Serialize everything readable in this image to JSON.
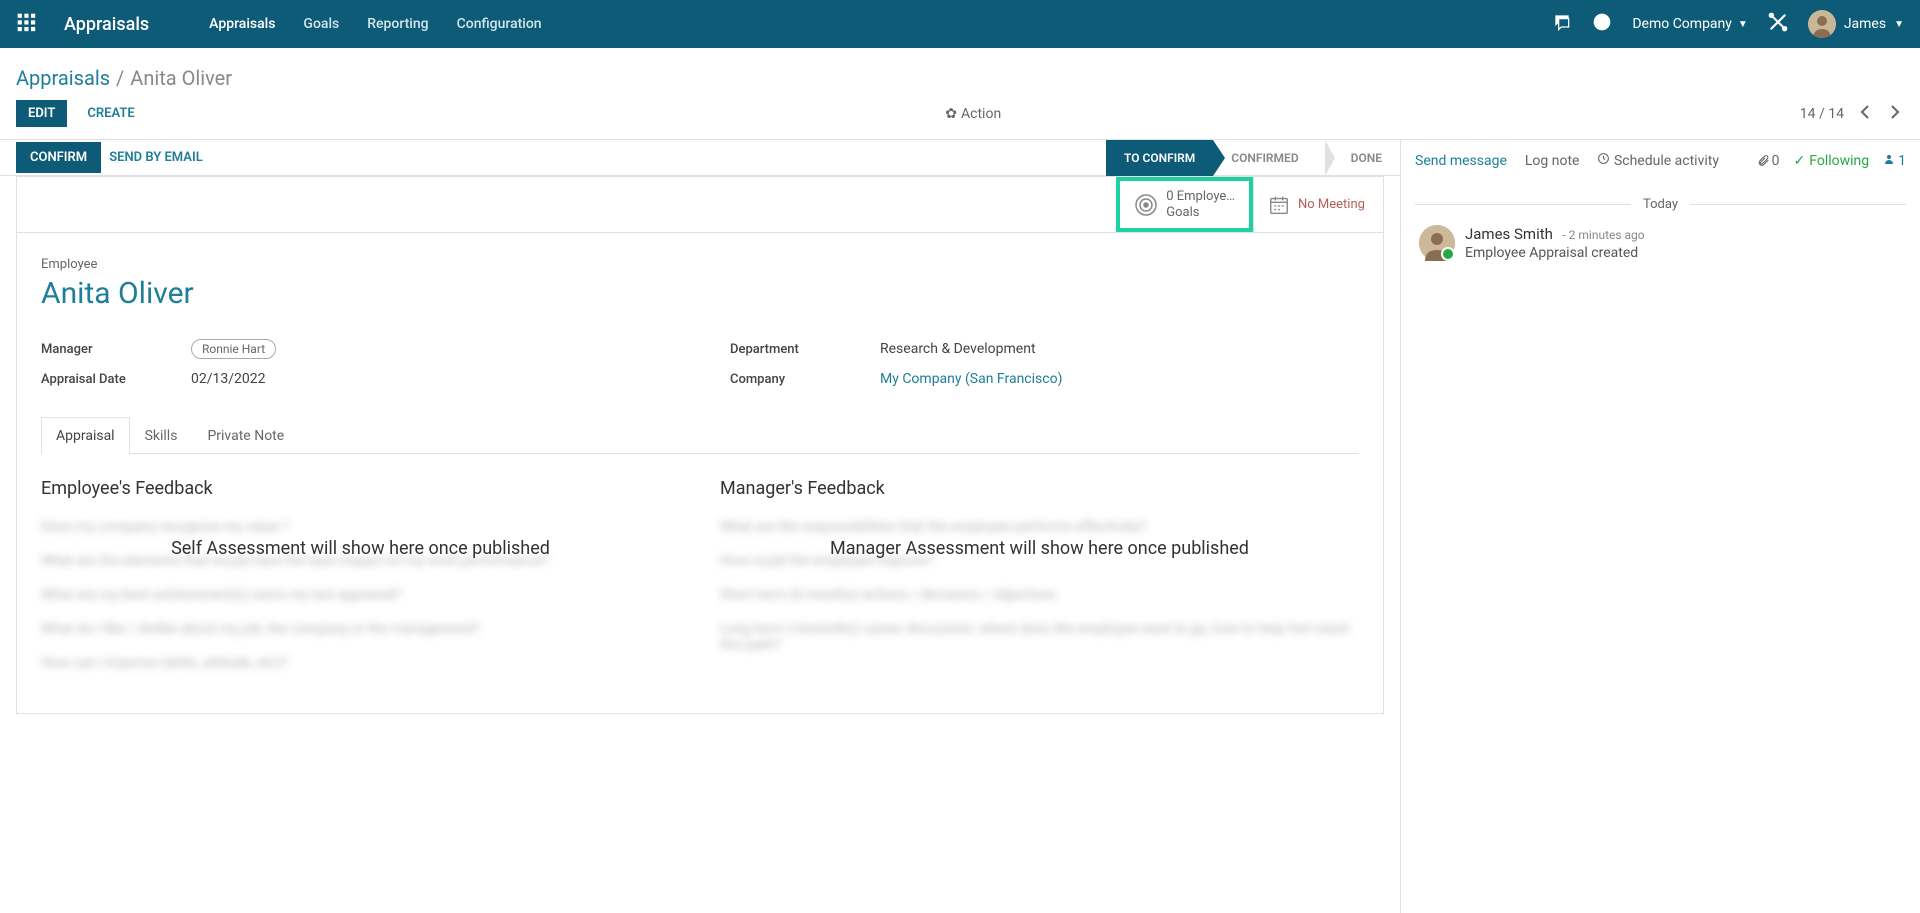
{
  "topbar": {
    "app_title": "Appraisals",
    "nav": [
      "Appraisals",
      "Goals",
      "Reporting",
      "Configuration"
    ],
    "company": "Demo Company",
    "user": "James"
  },
  "breadcrumb": {
    "root": "Appraisals",
    "current": "Anita Oliver"
  },
  "controls": {
    "edit": "EDIT",
    "create": "CREATE",
    "action": "Action",
    "pager": "14 / 14"
  },
  "statusbar": {
    "confirm": "CONFIRM",
    "send_email": "SEND BY EMAIL",
    "stages": [
      "TO CONFIRM",
      "CONFIRMED",
      "DONE"
    ]
  },
  "buttonbox": {
    "goals_line1": "0 Employe…",
    "goals_line2": "Goals",
    "meeting": "No Meeting"
  },
  "form": {
    "employee_label": "Employee",
    "employee_name": "Anita Oliver",
    "manager_label": "Manager",
    "manager_value": "Ronnie Hart",
    "date_label": "Appraisal Date",
    "date_value": "02/13/2022",
    "dept_label": "Department",
    "dept_value": "Research & Development",
    "company_label": "Company",
    "company_value": "My Company (San Francisco)"
  },
  "tabs": [
    "Appraisal",
    "Skills",
    "Private Note"
  ],
  "feedback": {
    "emp_title": "Employee's Feedback",
    "emp_placeholder": "Self Assessment will show here once published",
    "emp_blur": [
      "Does my company recognize my value ?",
      "What are the elements that would have the best impact on my work performance?",
      "What are my best achievement(s) since my last appraisal?",
      "What do I like / dislike about my job, the company or the management?",
      "How can I improve (skills, attitude, etc)?"
    ],
    "mgr_title": "Manager's Feedback",
    "mgr_placeholder": "Manager Assessment will show here once published",
    "mgr_blur": [
      "What are the responsibilities that the employee performs effectively?",
      "How could the employee improve?",
      "Short term (6-months) actions / decisions / objectives",
      "Long term (>6months) career discussion, where does the employee want to go, how to help him reach this path?"
    ]
  },
  "chatter": {
    "send": "Send message",
    "log": "Log note",
    "schedule": "Schedule activity",
    "attach_count": "0",
    "following": "Following",
    "follower_count": "1",
    "today": "Today",
    "msg_author": "James Smith",
    "msg_time": "- 2 minutes ago",
    "msg_text": "Employee Appraisal created"
  }
}
